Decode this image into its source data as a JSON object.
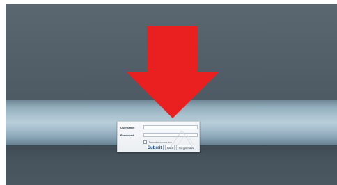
{
  "login": {
    "username_label": "Username:",
    "password_label": "Password:",
    "remember_label": "Remember me next time",
    "submit_label": "Submit",
    "back_label": "Back",
    "forgot_label": "Forgot Pass"
  },
  "colors": {
    "arrow": "#e9201f",
    "background": "#505c66",
    "band": "#b3cad6",
    "login_panel": "#f2f4f6"
  },
  "icons": {
    "annotation_arrow": "arrow-down-icon"
  }
}
